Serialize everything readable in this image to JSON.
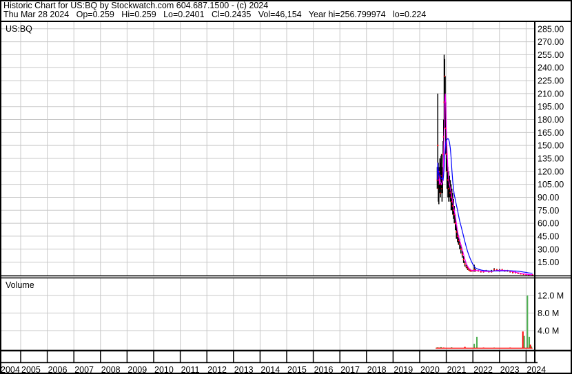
{
  "header": {
    "title": "Historic Chart for US:BQ by Stockwatch.com 604.687.1500 - (c) 2024",
    "quote": "Thu Mar 28 2024   Op=0.259   Hi=0.259   Lo=0.2401   Cl=0.2435   Vol=46,154   Year hi=256.799974   lo=0.224"
  },
  "chart_data": [
    {
      "type": "line",
      "title": "US:BQ",
      "ylim": [
        0,
        292
      ],
      "yticks": [
        "15.00",
        "30.00",
        "45.00",
        "60.00",
        "75.00",
        "90.00",
        "105.00",
        "120.00",
        "135.00",
        "150.00",
        "165.00",
        "180.00",
        "195.00",
        "210.00",
        "225.00",
        "240.00",
        "255.00",
        "270.00",
        "285.00"
      ],
      "x_years": [
        "2004",
        "2005",
        "2006",
        "2007",
        "2008",
        "2009",
        "2010",
        "2011",
        "2012",
        "2013",
        "2014",
        "2015",
        "2016",
        "2017",
        "2018",
        "2019",
        "2020",
        "2021",
        "2022",
        "2023",
        "2024"
      ],
      "series_colors": {
        "price": "#000000",
        "close": "#ff0000",
        "ma_short": "#ff00ff",
        "ma_long": "#0000ff"
      },
      "points": [
        [
          2020.66,
          110,
          125,
          100
        ],
        [
          2020.68,
          150,
          210,
          115
        ],
        [
          2020.7,
          100,
          130,
          85
        ],
        [
          2020.72,
          110,
          125,
          82
        ],
        [
          2020.74,
          105,
          120,
          95
        ],
        [
          2020.76,
          120,
          135,
          100
        ],
        [
          2020.78,
          95,
          130,
          90
        ],
        [
          2020.8,
          105,
          138,
          95
        ],
        [
          2020.82,
          115,
          140,
          100
        ],
        [
          2020.84,
          100,
          125,
          85
        ],
        [
          2020.86,
          110,
          120,
          95
        ],
        [
          2020.88,
          140,
          155,
          120
        ],
        [
          2020.9,
          160,
          180,
          140
        ],
        [
          2020.92,
          200,
          255,
          170
        ],
        [
          2020.94,
          230,
          250,
          190
        ],
        [
          2020.96,
          200,
          230,
          170
        ],
        [
          2020.98,
          170,
          200,
          140
        ],
        [
          2021.0,
          140,
          165,
          120
        ],
        [
          2021.03,
          120,
          135,
          100
        ],
        [
          2021.06,
          110,
          125,
          90
        ],
        [
          2021.09,
          100,
          120,
          85
        ],
        [
          2021.12,
          105,
          115,
          90
        ],
        [
          2021.15,
          95,
          110,
          85
        ],
        [
          2021.18,
          90,
          105,
          75
        ],
        [
          2021.21,
          85,
          100,
          75
        ],
        [
          2021.24,
          80,
          95,
          70
        ],
        [
          2021.27,
          75,
          88,
          65
        ],
        [
          2021.3,
          70,
          80,
          60
        ],
        [
          2021.34,
          60,
          70,
          52
        ],
        [
          2021.38,
          50,
          58,
          42
        ],
        [
          2021.42,
          45,
          52,
          38
        ],
        [
          2021.46,
          40,
          46,
          35
        ],
        [
          2021.5,
          36,
          42,
          30
        ],
        [
          2021.55,
          30,
          35,
          25
        ],
        [
          2021.6,
          24,
          28,
          20
        ],
        [
          2021.65,
          18,
          22,
          14
        ],
        [
          2021.7,
          13,
          16,
          10
        ],
        [
          2021.75,
          10,
          12,
          8
        ],
        [
          2021.8,
          8,
          10,
          6
        ],
        [
          2021.85,
          6,
          8,
          5
        ],
        [
          2021.9,
          5,
          7,
          4
        ],
        [
          2021.95,
          5,
          6,
          4
        ],
        [
          2022.0,
          5,
          6,
          4
        ],
        [
          2022.05,
          6,
          12,
          4
        ],
        [
          2022.1,
          5,
          7,
          4
        ],
        [
          2022.2,
          5,
          6,
          4
        ],
        [
          2022.3,
          4,
          5,
          3
        ],
        [
          2022.4,
          4,
          5,
          3
        ],
        [
          2022.5,
          5,
          6,
          4
        ],
        [
          2022.6,
          4,
          5,
          3
        ],
        [
          2022.7,
          4,
          6,
          3
        ],
        [
          2022.8,
          6,
          8,
          5
        ],
        [
          2022.9,
          6,
          7,
          5
        ],
        [
          2023.0,
          5,
          7,
          4
        ],
        [
          2023.1,
          6,
          7,
          5
        ],
        [
          2023.2,
          5,
          6,
          4
        ],
        [
          2023.3,
          5,
          6,
          4
        ],
        [
          2023.4,
          4,
          5,
          3
        ],
        [
          2023.5,
          3,
          4,
          2
        ],
        [
          2023.6,
          3,
          4,
          2
        ],
        [
          2023.7,
          2,
          3,
          1.5
        ],
        [
          2023.8,
          1.5,
          2,
          1
        ],
        [
          2023.9,
          1,
          1.5,
          0.7
        ],
        [
          2024.0,
          0.7,
          1,
          0.5
        ],
        [
          2024.1,
          0.4,
          0.6,
          0.3
        ],
        [
          2024.24,
          0.2435,
          0.259,
          0.2401
        ]
      ]
    },
    {
      "type": "bar",
      "title": "Volume",
      "ylim": [
        0,
        14500000
      ],
      "yticks": [
        "4.0 M",
        "8.0 M",
        "12.0 M"
      ],
      "bars": [
        [
          2020.66,
          200000,
          "g"
        ],
        [
          2020.72,
          150000,
          "r"
        ],
        [
          2020.8,
          250000,
          "g"
        ],
        [
          2020.9,
          150000,
          "r"
        ],
        [
          2021.2,
          200000,
          "g"
        ],
        [
          2021.7,
          300000,
          "r"
        ],
        [
          2022.05,
          1000000,
          "g"
        ],
        [
          2022.15,
          2600000,
          "g"
        ],
        [
          2022.4,
          150000,
          "r"
        ],
        [
          2022.8,
          150000,
          "g"
        ],
        [
          2023.4,
          150000,
          "r"
        ],
        [
          2023.88,
          3800000,
          "r"
        ],
        [
          2023.93,
          2800000,
          "g"
        ],
        [
          2024.05,
          12000000,
          "g"
        ],
        [
          2024.12,
          2600000,
          "g"
        ],
        [
          2024.16,
          800000,
          "r"
        ],
        [
          2024.2,
          400000,
          "g"
        ]
      ]
    }
  ]
}
